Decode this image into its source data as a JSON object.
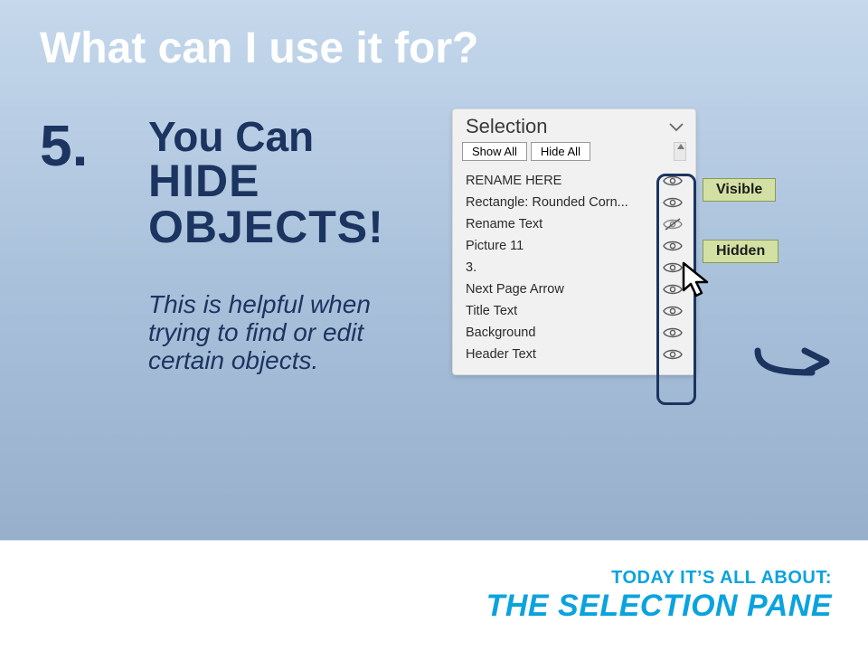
{
  "title": "What can I use it for?",
  "number": "5.",
  "headline": {
    "l1": "You Can",
    "l2": "HIDE",
    "l3": "OBJECTS!"
  },
  "subtitle": "This is helpful when trying to find or edit certain objects.",
  "pane": {
    "title": "Selection",
    "show_all": "Show All",
    "hide_all": "Hide All",
    "items": [
      {
        "label": "RENAME HERE",
        "hidden": false
      },
      {
        "label": "Rectangle: Rounded Corn...",
        "hidden": false
      },
      {
        "label": "Rename Text",
        "hidden": true
      },
      {
        "label": "Picture 11",
        "hidden": false
      },
      {
        "label": "3.",
        "hidden": false
      },
      {
        "label": "Next Page Arrow",
        "hidden": false
      },
      {
        "label": "Title Text",
        "hidden": false
      },
      {
        "label": "Background",
        "hidden": false
      },
      {
        "label": "Header Text",
        "hidden": false
      }
    ]
  },
  "tags": {
    "visible": "Visible",
    "hidden": "Hidden"
  },
  "footer": {
    "line1": "TODAY IT’S ALL ABOUT:",
    "line2": "THE SELECTION PANE"
  }
}
